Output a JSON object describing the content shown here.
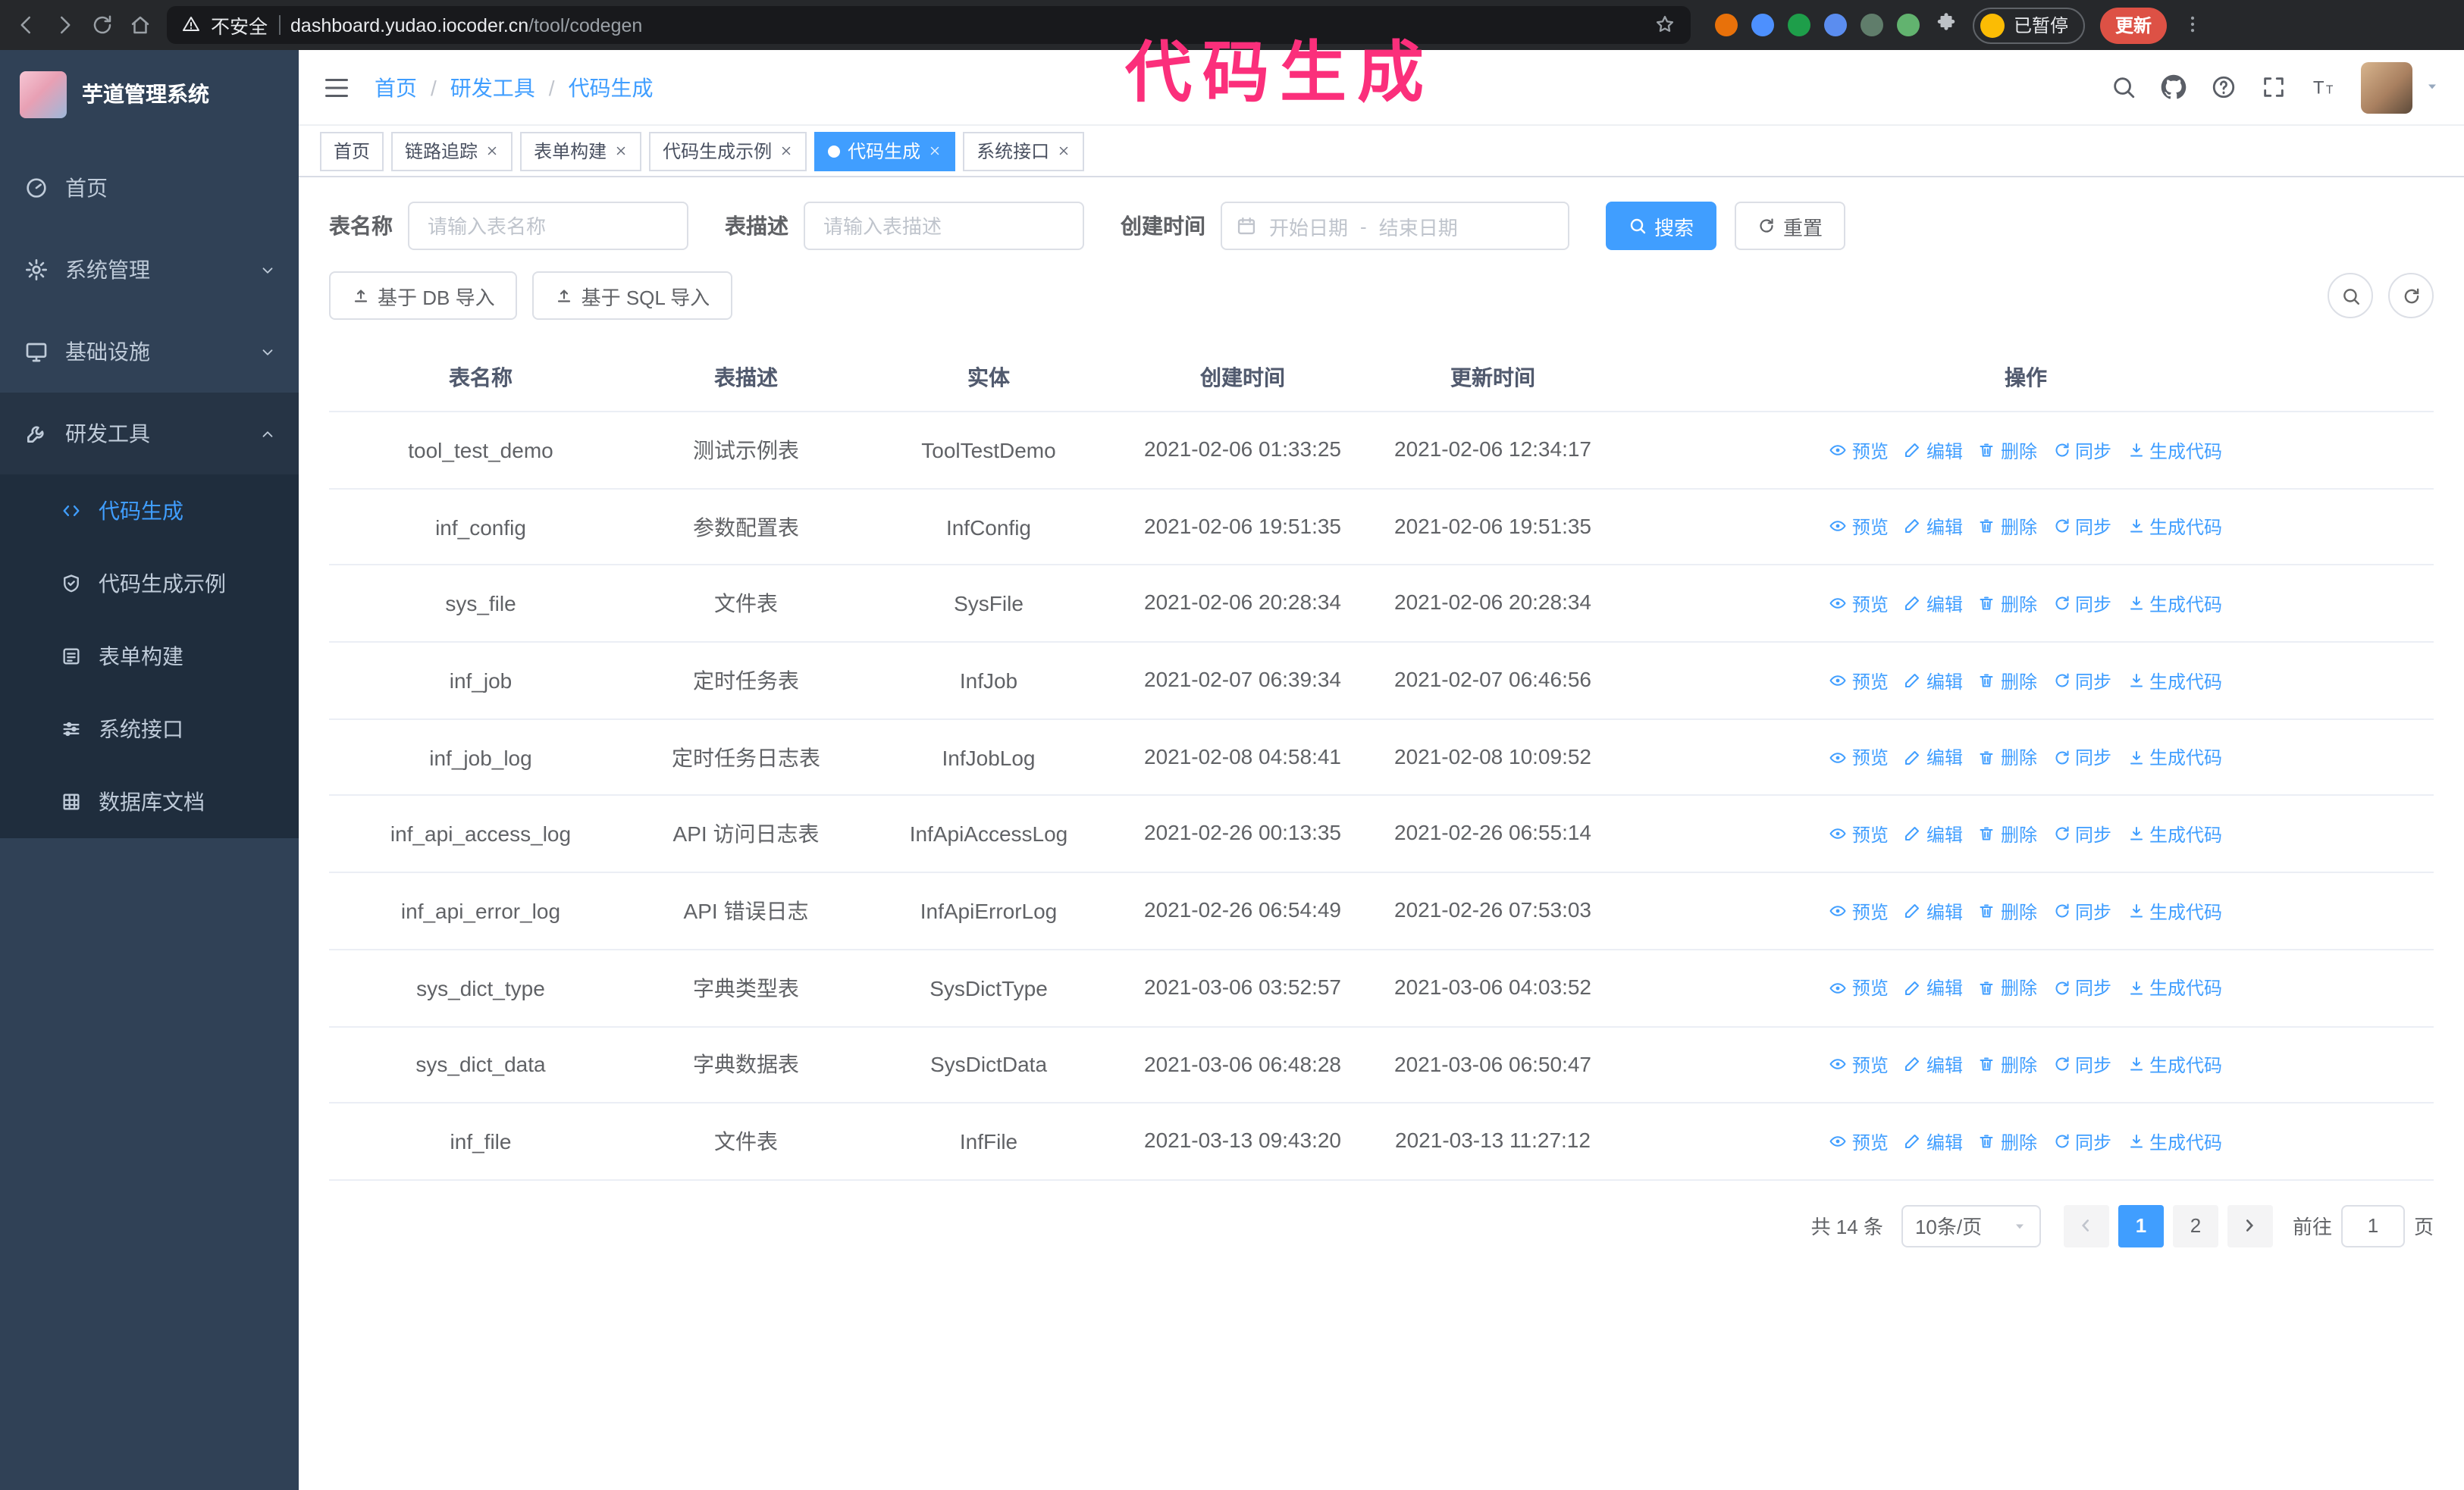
{
  "browser": {
    "security_label": "不安全",
    "url_host": "dashboard.yudao.iocoder.cn",
    "url_path": "/tool/codegen",
    "paused_label": "已暂停",
    "update_label": "更新",
    "extensions": [
      {
        "name": "extension-icon-1",
        "color": "#e8710a"
      },
      {
        "name": "extension-icon-2",
        "color": "#4d90fe"
      },
      {
        "name": "extension-icon-3",
        "color": "#1e9e4a"
      },
      {
        "name": "extension-icon-4",
        "color": "#5b8def"
      },
      {
        "name": "extension-icon-5",
        "color": "#607d6b"
      },
      {
        "name": "extension-icon-6",
        "color": "#62b36f"
      }
    ]
  },
  "overlay": {
    "text": "代码生成"
  },
  "sidebar": {
    "title": "芋道管理系统",
    "items": [
      {
        "id": "home",
        "label": "首页",
        "icon": "dashboard-icon"
      },
      {
        "id": "system",
        "label": "系统管理",
        "icon": "gear-icon",
        "arrow": "down"
      },
      {
        "id": "infra",
        "label": "基础设施",
        "icon": "monitor-icon",
        "arrow": "down"
      },
      {
        "id": "devtools",
        "label": "研发工具",
        "icon": "tools-icon",
        "arrow": "up",
        "expanded": true
      }
    ],
    "submenu": [
      {
        "id": "codegen",
        "label": "代码生成",
        "icon": "code-icon",
        "active": true
      },
      {
        "id": "codegen-example",
        "label": "代码生成示例",
        "icon": "shield-icon"
      },
      {
        "id": "form-builder",
        "label": "表单构建",
        "icon": "form-icon"
      },
      {
        "id": "api",
        "label": "系统接口",
        "icon": "sliders-icon"
      },
      {
        "id": "db-doc",
        "label": "数据库文档",
        "icon": "grid-icon"
      }
    ]
  },
  "header": {
    "breadcrumb": [
      "首页",
      "研发工具",
      "代码生成"
    ]
  },
  "tabs": [
    {
      "id": "home",
      "label": "首页",
      "closable": false,
      "active": false
    },
    {
      "id": "tracer",
      "label": "链路追踪",
      "closable": true,
      "active": false
    },
    {
      "id": "form-builder",
      "label": "表单构建",
      "closable": true,
      "active": false
    },
    {
      "id": "codegen-example",
      "label": "代码生成示例",
      "closable": true,
      "active": false
    },
    {
      "id": "codegen",
      "label": "代码生成",
      "closable": true,
      "active": true
    },
    {
      "id": "api",
      "label": "系统接口",
      "closable": true,
      "active": false
    }
  ],
  "filters": {
    "table_name_label": "表名称",
    "table_name_placeholder": "请输入表名称",
    "table_desc_label": "表描述",
    "table_desc_placeholder": "请输入表描述",
    "create_time_label": "创建时间",
    "date_start_placeholder": "开始日期",
    "date_separator": "-",
    "date_end_placeholder": "结束日期",
    "search_label": "搜索",
    "reset_label": "重置"
  },
  "toolbar": {
    "import_db": "基于 DB 导入",
    "import_sql": "基于 SQL 导入"
  },
  "table": {
    "columns": [
      "表名称",
      "表描述",
      "实体",
      "创建时间",
      "更新时间",
      "操作"
    ],
    "actions": [
      {
        "id": "preview",
        "label": "预览",
        "icon": "eye-icon"
      },
      {
        "id": "edit",
        "label": "编辑",
        "icon": "edit-icon"
      },
      {
        "id": "delete",
        "label": "删除",
        "icon": "delete-icon"
      },
      {
        "id": "sync",
        "label": "同步",
        "icon": "sync-icon"
      },
      {
        "id": "generate",
        "label": "生成代码",
        "icon": "download-icon"
      }
    ],
    "rows": [
      {
        "name": "tool_test_demo",
        "desc": "测试示例表",
        "entity": "ToolTestDemo",
        "created": "2021-02-06 01:33:25",
        "updated": "2021-02-06 12:34:17"
      },
      {
        "name": "inf_config",
        "desc": "参数配置表",
        "entity": "InfConfig",
        "created": "2021-02-06 19:51:35",
        "updated": "2021-02-06 19:51:35"
      },
      {
        "name": "sys_file",
        "desc": "文件表",
        "entity": "SysFile",
        "created": "2021-02-06 20:28:34",
        "updated": "2021-02-06 20:28:34"
      },
      {
        "name": "inf_job",
        "desc": "定时任务表",
        "entity": "InfJob",
        "created": "2021-02-07 06:39:34",
        "updated": "2021-02-07 06:46:56"
      },
      {
        "name": "inf_job_log",
        "desc": "定时任务日志表",
        "entity": "InfJobLog",
        "created": "2021-02-08 04:58:41",
        "updated": "2021-02-08 10:09:52"
      },
      {
        "name": "inf_api_access_log",
        "desc": "API 访问日志表",
        "entity": "InfApiAccessLog",
        "created": "2021-02-26 00:13:35",
        "updated": "2021-02-26 06:55:14"
      },
      {
        "name": "inf_api_error_log",
        "desc": "API 错误日志",
        "entity": "InfApiErrorLog",
        "created": "2021-02-26 06:54:49",
        "updated": "2021-02-26 07:53:03"
      },
      {
        "name": "sys_dict_type",
        "desc": "字典类型表",
        "entity": "SysDictType",
        "created": "2021-03-06 03:52:57",
        "updated": "2021-03-06 04:03:52"
      },
      {
        "name": "sys_dict_data",
        "desc": "字典数据表",
        "entity": "SysDictData",
        "created": "2021-03-06 06:48:28",
        "updated": "2021-03-06 06:50:47"
      },
      {
        "name": "inf_file",
        "desc": "文件表",
        "entity": "InfFile",
        "created": "2021-03-13 09:43:20",
        "updated": "2021-03-13 11:27:12"
      }
    ]
  },
  "pagination": {
    "total_label": "共 14 条",
    "page_size_label": "10条/页",
    "pages": [
      {
        "label": "1",
        "active": true
      },
      {
        "label": "2",
        "active": false
      }
    ],
    "goto_label": "前往",
    "goto_value": "1",
    "goto_suffix": "页"
  },
  "colors": {
    "primary": "#409eff",
    "sidebar_bg": "#304156",
    "submenu_bg": "#1f2d3d",
    "annotation_pink": "#fb2f7b",
    "chrome_bg": "#26282b",
    "update_button_red": "#dd5145"
  }
}
